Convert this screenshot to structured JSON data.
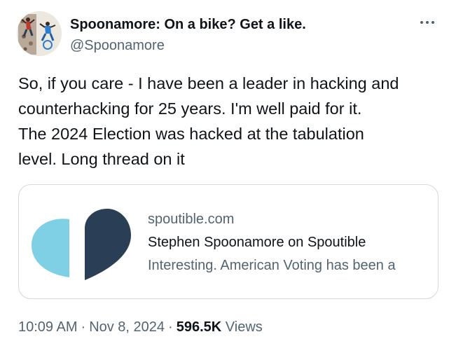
{
  "author": {
    "display_name": "Spoonamore: On a bike? Get a like.",
    "handle": "@Spoonamore"
  },
  "tweet": {
    "text": "So, if you care - I have been a leader in hacking and\ncounterhacking for 25 years.  I'm well paid for it.\nThe 2024 Election was hacked at the tabulation\nlevel.  Long thread on it"
  },
  "link_card": {
    "domain": "spoutible.com",
    "title": "Stephen Spoonamore on Spoutible",
    "description": "Interesting. American Voting has been a"
  },
  "meta": {
    "time": "10:09 AM",
    "separator": "·",
    "date": "Nov 8, 2024",
    "views_count": "596.5K",
    "views_label": "Views"
  },
  "icons": {
    "more": "more-dots-icon",
    "avatar": "avatar-image",
    "card_logo": "spoutible-logo-icon"
  },
  "colors": {
    "text_primary": "#0f1419",
    "text_secondary": "#536471",
    "card_border": "#cfd9de",
    "logo_light_blue": "#7fd0e5",
    "logo_dark_navy": "#2a3e55"
  }
}
